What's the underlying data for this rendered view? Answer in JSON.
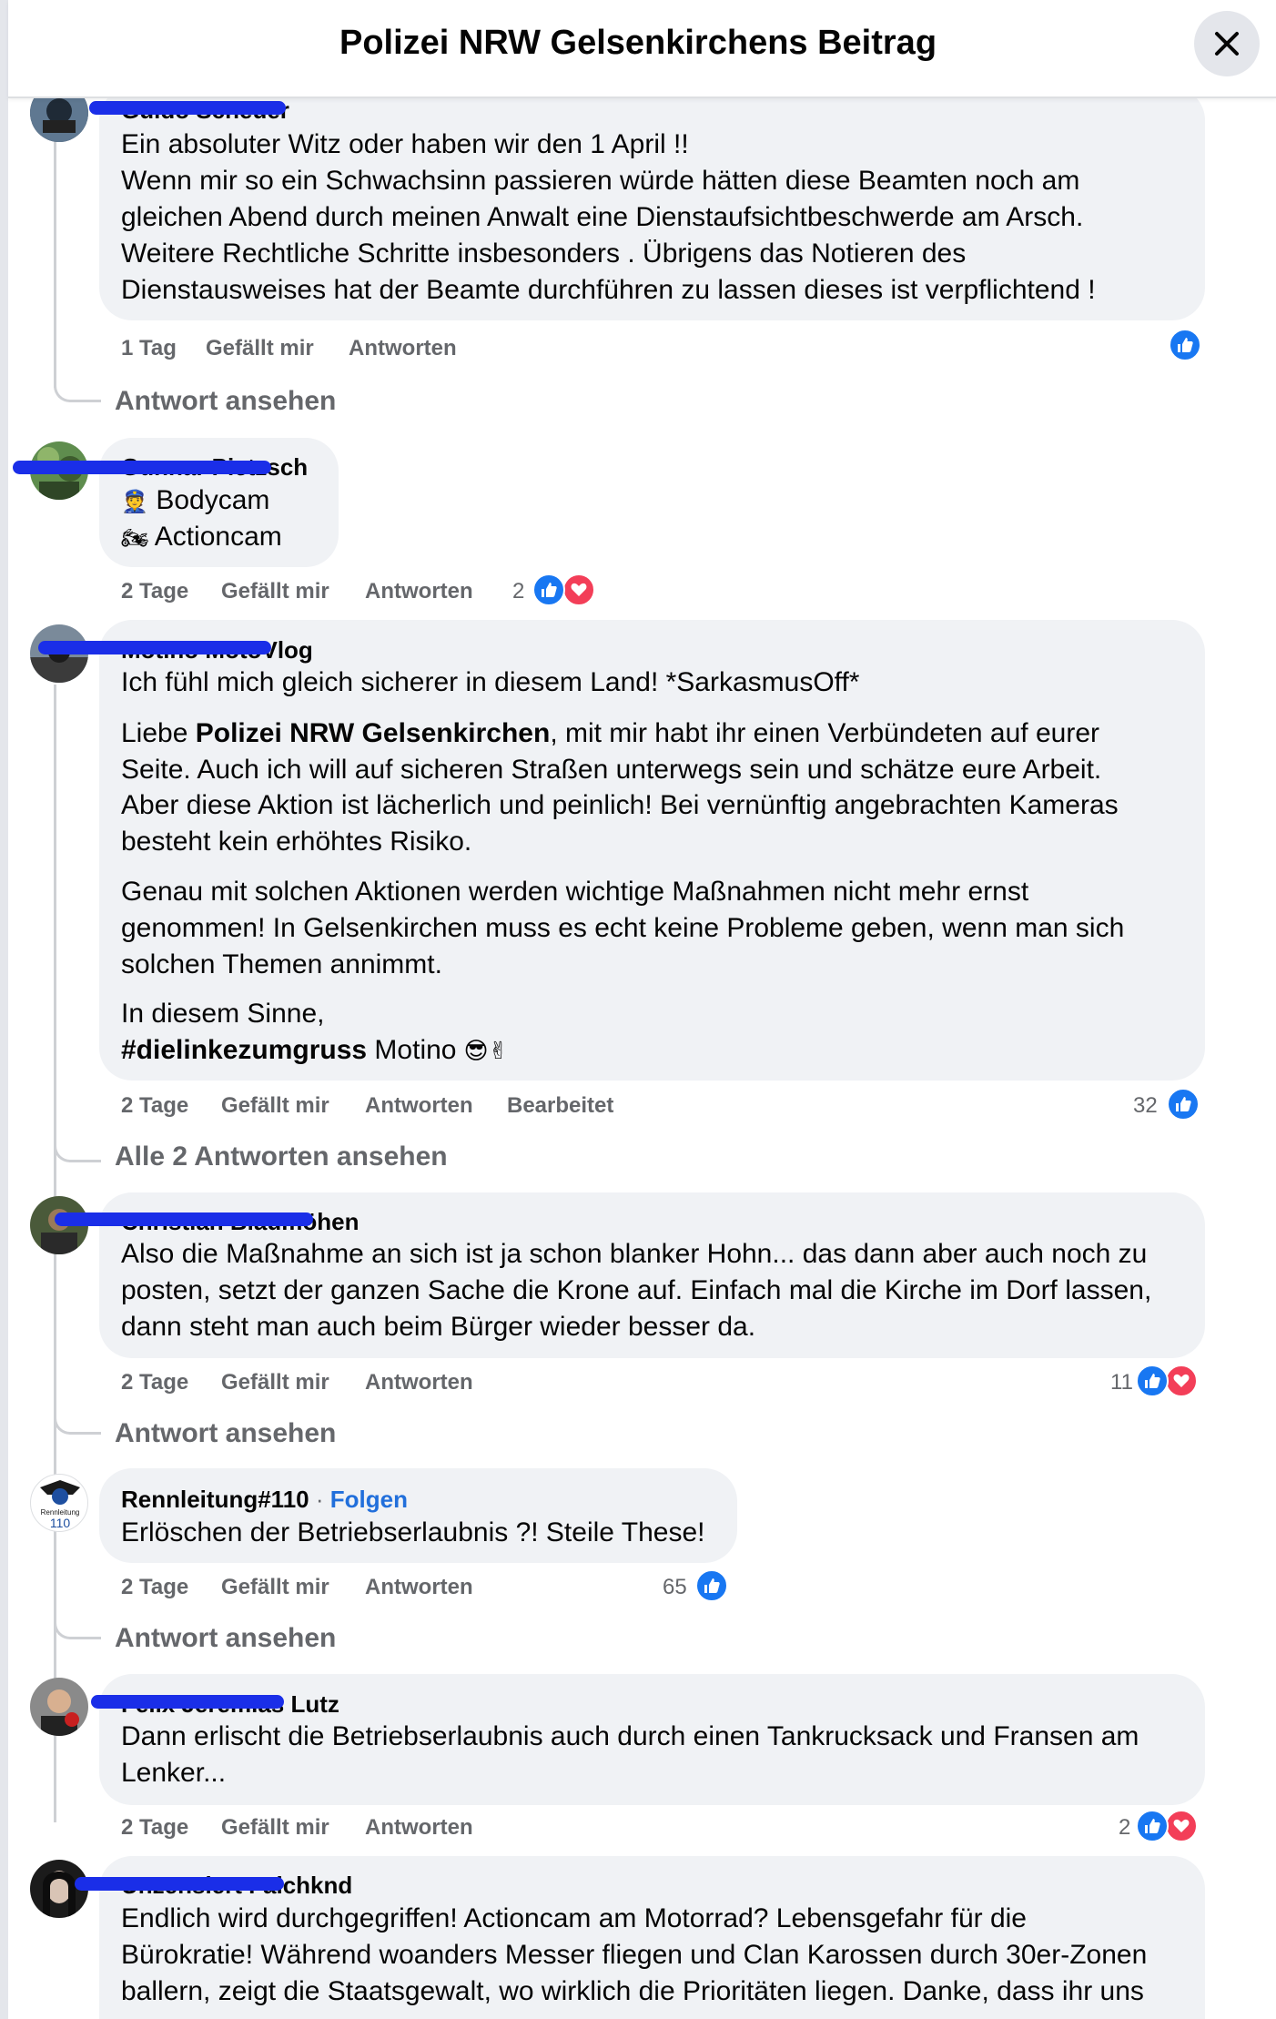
{
  "header": {
    "title": "Polizei NRW Gelsenkirchens Beitrag",
    "close_icon": "close-icon"
  },
  "comments": [
    {
      "author": "Guido Scheuer",
      "lines": [
        "Ein absoluter Witz oder haben wir den 1 April !!",
        "Wenn mir so ein Schwachsinn passieren würde hätten diese Beamten noch am",
        "gleichen Abend durch meinen Anwalt eine Dienstaufsichtbeschwerde am Arsch.",
        "Weitere Rechtliche Schritte insbesonders . Übrigens das Notieren des",
        "Dienstausweises hat der Beamte durchführen zu lassen dieses ist verpflichtend !"
      ],
      "time": "1 Tag",
      "like_label": "Gefällt mir",
      "reply_label": "Antworten",
      "reaction_count": "",
      "reactions": [
        "like"
      ],
      "view_replies": "Antwort ansehen"
    },
    {
      "author": "Gunnar Pietzsch",
      "lines": [
        "Bodycam",
        "Actioncam"
      ],
      "line_icons": [
        "police-officer-emoji",
        "motorcycle-emoji"
      ],
      "time": "2 Tage",
      "like_label": "Gefällt mir",
      "reply_label": "Antworten",
      "reaction_count": "2",
      "reactions": [
        "like",
        "love"
      ]
    },
    {
      "author": "Motino MotoVlog",
      "line1": "Ich fühl mich gleich sicherer in diesem Land! *SarkasmusOff*",
      "p1_prefix": "Liebe ",
      "p1_bold": "Polizei NRW Gelsenkirchen",
      "p1_rest": ", mit mir habt ihr einen Verbündeten auf eurer",
      "p1_lines": [
        "Seite. Auch ich will auf sicheren Straßen unterwegs sein und schätze eure Arbeit.",
        "Aber diese Aktion ist lächerlich und peinlich! Bei vernünftig angebrachten Kameras",
        "besteht kein erhöhtes Risiko."
      ],
      "p2_lines": [
        "Genau mit solchen Aktionen werden wichtige Maßnahmen nicht mehr ernst",
        "genommen! In Gelsenkirchen muss es echt keine Probleme geben, wenn man sich",
        "solchen Themen annimmt."
      ],
      "p3_line1": "In diesem Sinne,",
      "p3_hashtag": "#dielinkezumgruss",
      "p3_name": " Motino",
      "p3_icons": [
        "sunglasses-emoji",
        "victory-hand-emoji"
      ],
      "time": "2 Tage",
      "like_label": "Gefällt mir",
      "reply_label": "Antworten",
      "edited_label": "Bearbeitet",
      "reaction_count": "32",
      "reactions": [
        "like"
      ],
      "view_replies": "Alle 2 Antworten ansehen"
    },
    {
      "author": "Christian Blaumöhen",
      "lines": [
        "Also die Maßnahme an sich ist ja schon blanker Hohn... das dann aber auch noch zu",
        "posten, setzt der ganzen Sache die Krone auf. Einfach mal die Kirche im Dorf lassen,",
        "dann steht man auch beim Bürger wieder besser da."
      ],
      "time": "2 Tage",
      "like_label": "Gefällt mir",
      "reply_label": "Antworten",
      "reaction_count": "11",
      "reactions": [
        "like",
        "love"
      ],
      "view_replies": "Antwort ansehen"
    },
    {
      "author": "Rennleitung#110",
      "follow_label": "Folgen",
      "avatar_text": "Rennleitung",
      "avatar_num": "110",
      "lines": [
        "Erlöschen der Betriebserlaubnis ?! Steile These!"
      ],
      "time": "2 Tage",
      "like_label": "Gefällt mir",
      "reply_label": "Antworten",
      "reaction_count": "65",
      "reactions": [
        "like"
      ],
      "view_replies": "Antwort ansehen"
    },
    {
      "author": "Felix Jeremias Lutz",
      "lines": [
        "Dann erlischt die Betriebserlaubnis auch durch einen Tankrucksack und Fransen am",
        "Lenker..."
      ],
      "time": "2 Tage",
      "like_label": "Gefällt mir",
      "reply_label": "Antworten",
      "reaction_count": "2",
      "reactions": [
        "like",
        "love"
      ]
    },
    {
      "author": "Unzensiert Falchknd",
      "lines": [
        "Endlich wird durchgegriffen! Actioncam am Motorrad? Lebensgefahr für die",
        "Bürokratie! Während woanders Messer fliegen und Clan Karossen durch 30er-Zonen",
        "ballern, zeigt die Staatsgewalt, wo wirklich die Prioritäten liegen. Danke, dass ihr uns"
      ]
    }
  ],
  "colors": {
    "like": "#1877f2",
    "love": "#f33e58",
    "bubble": "#f0f2f5",
    "meta": "#65676b",
    "link": "#216fdb"
  }
}
